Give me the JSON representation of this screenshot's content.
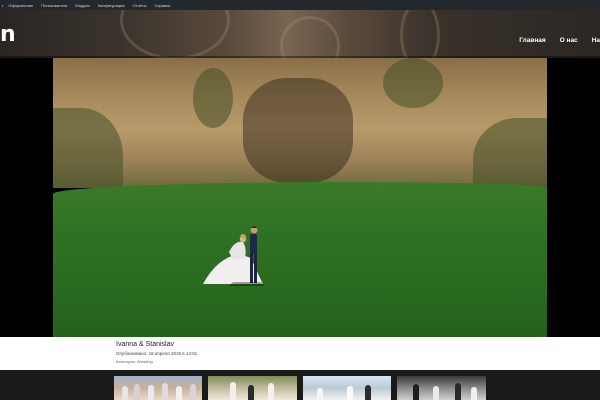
{
  "admin_bar": {
    "items": [
      "Оформление",
      "Пользователи",
      "Модули",
      "Конфигурация",
      "Отчёты",
      "Справка"
    ]
  },
  "header": {
    "logo": "n",
    "nav": [
      "Главная",
      "О нас",
      "На"
    ]
  },
  "post": {
    "title": "Ivanna & Stanislav",
    "published": "Опубликовано: 18 апреля 2019 в 14:01",
    "category": "Категория: Wedding"
  },
  "colors": {
    "admin_bar_bg": "#23282d",
    "grass": "#2f7124",
    "cliff": "#a78a5c"
  }
}
